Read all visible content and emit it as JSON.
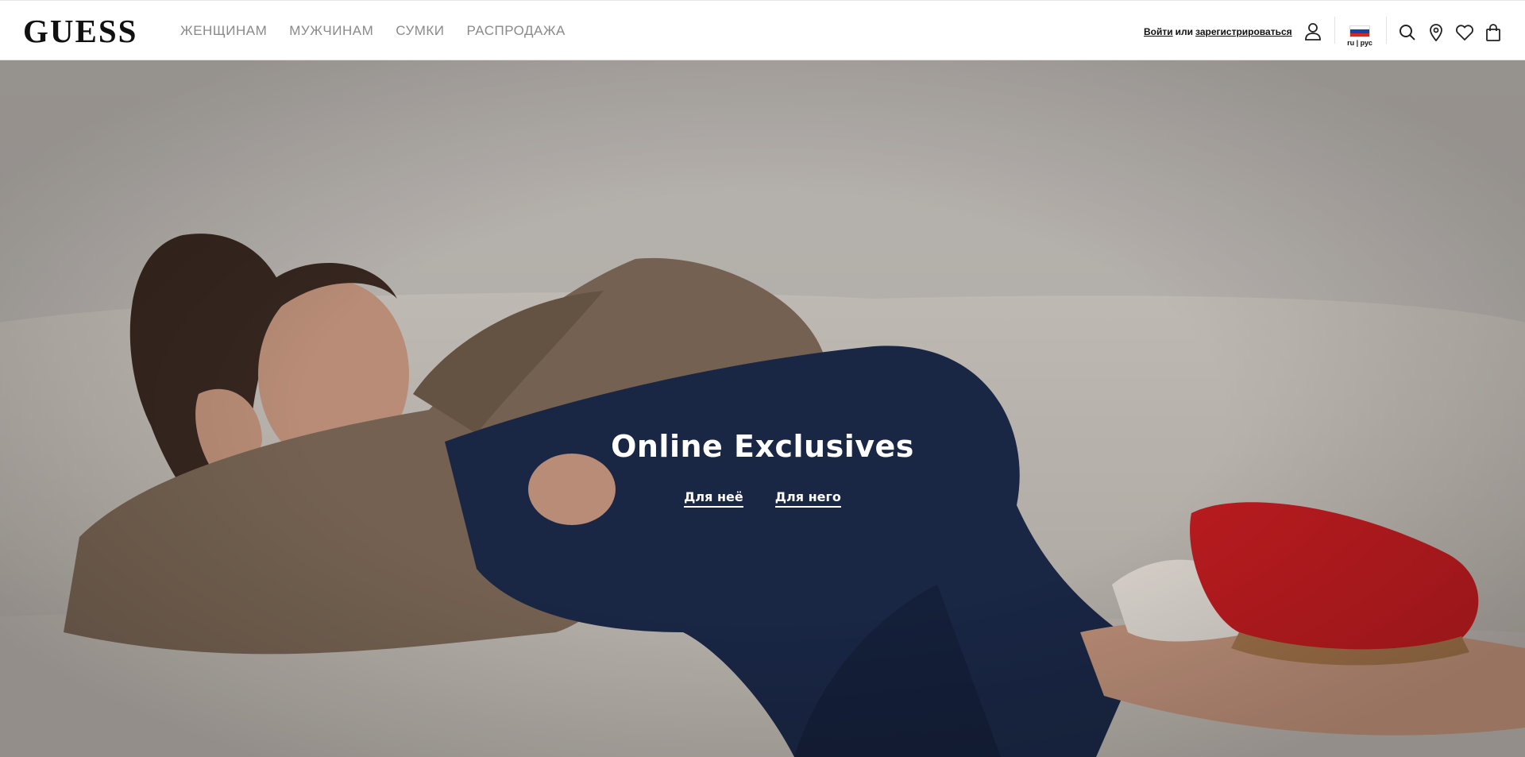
{
  "brand": {
    "logo_text": "GUESS"
  },
  "nav": {
    "items": [
      {
        "label": "ЖЕНЩИНАМ"
      },
      {
        "label": "МУЖЧИНАМ"
      },
      {
        "label": "СУМКИ"
      },
      {
        "label": "РАСПРОДАЖА"
      }
    ]
  },
  "account": {
    "login_label": "Войти",
    "or_label": "или",
    "register_label": "зарегистрироваться"
  },
  "language": {
    "label": "ru | рус",
    "flag_colors": [
      "#ffffff",
      "#1c3faa",
      "#e1251b"
    ]
  },
  "icons": {
    "user": "user-icon",
    "search": "search-icon",
    "store": "location-pin-icon",
    "wishlist": "heart-icon",
    "bag": "shopping-bag-icon"
  },
  "hero": {
    "title": "Online Exclusives",
    "links": [
      {
        "label": "Для неё"
      },
      {
        "label": "Для него"
      }
    ]
  }
}
